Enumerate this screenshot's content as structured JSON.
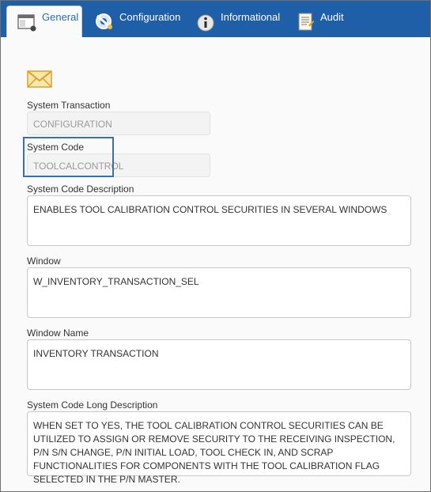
{
  "tabs": [
    {
      "label": "General",
      "icon": "window-icon",
      "active": true
    },
    {
      "label": "Configuration",
      "icon": "gear-icon",
      "active": false
    },
    {
      "label": "Informational",
      "icon": "info-icon",
      "active": false
    },
    {
      "label": "Audit",
      "icon": "document-icon",
      "active": false
    }
  ],
  "fields": {
    "system_transaction": {
      "label": "System Transaction",
      "value": "CONFIGURATION"
    },
    "system_code": {
      "label": "System Code",
      "value": "TOOLCALCONTROL"
    },
    "system_code_description": {
      "label": "System Code Description",
      "value": "ENABLES TOOL CALIBRATION CONTROL SECURITIES IN SEVERAL WINDOWS"
    },
    "window": {
      "label": "Window",
      "value": "W_INVENTORY_TRANSACTION_SEL"
    },
    "window_name": {
      "label": "Window Name",
      "value": "INVENTORY TRANSACTION"
    },
    "long_description": {
      "label": "System Code Long Description",
      "value": "WHEN SET TO YES, THE TOOL CALIBRATION CONTROL SECURITIES CAN BE UTILIZED TO ASSIGN OR REMOVE SECURITY TO THE RECEIVING INSPECTION, P/N S/N CHANGE, P/N INITIAL LOAD, TOOL CHECK IN, AND SCRAP FUNCTIONALITIES FOR COMPONENTS WITH THE TOOL CALIBRATION FLAG SELECTED IN THE P/N MASTER."
    }
  },
  "colors": {
    "tabbar": "#1f5fa8",
    "highlight": "#3a6fb0"
  }
}
